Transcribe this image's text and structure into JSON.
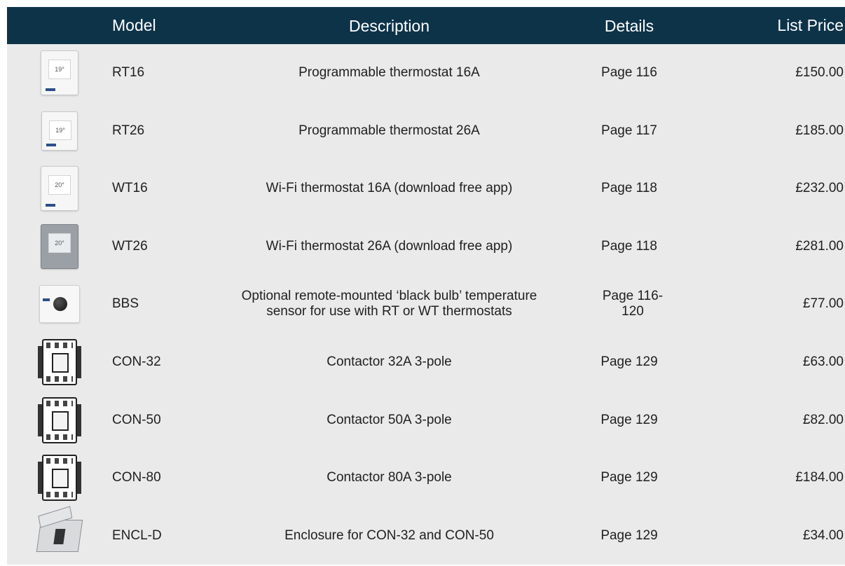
{
  "header": {
    "model": "Model",
    "description": "Description",
    "details": "Details",
    "price": "List Price"
  },
  "colors": {
    "header_bg": "#0d3349",
    "body_bg": "#eaeaea"
  },
  "rows": [
    {
      "image": "rt16-thermostat-image",
      "model": "RT16",
      "description": "Programmable thermostat 16A",
      "details": "Page 116",
      "price": "£150.00"
    },
    {
      "image": "rt26-thermostat-image",
      "model": "RT26",
      "description": "Programmable thermostat 26A",
      "details": "Page 117",
      "price": "£185.00"
    },
    {
      "image": "wt16-thermostat-image",
      "model": "WT16",
      "description": "Wi-Fi thermostat 16A (download free app)",
      "details": "Page 118",
      "price": "£232.00"
    },
    {
      "image": "wt26-thermostat-image",
      "model": "WT26",
      "description": "Wi-Fi thermostat 26A (download free app)",
      "details": "Page 118",
      "price": "£281.00"
    },
    {
      "image": "bbs-sensor-image",
      "model": "BBS",
      "description_line1": "Optional remote-mounted ‘black bulb’ temperature",
      "description_line2": "sensor for use with RT or WT thermostats",
      "details_line1": "Page 116-",
      "details_line2": "120",
      "price": "£77.00"
    },
    {
      "image": "contactor-image",
      "model": "CON-32",
      "description": "Contactor 32A 3-pole",
      "details": "Page 129",
      "price": "£63.00"
    },
    {
      "image": "contactor-image",
      "model": "CON-50",
      "description": "Contactor 50A 3-pole",
      "details": "Page 129",
      "price": "£82.00"
    },
    {
      "image": "contactor-image",
      "model": "CON-80",
      "description": "Contactor 80A 3-pole",
      "details": "Page 129",
      "price": "£184.00"
    },
    {
      "image": "enclosure-image",
      "model": "ENCL-D",
      "description": "Enclosure for CON-32 and CON-50",
      "details": "Page 129",
      "price": "£34.00"
    }
  ],
  "thumb_text": {
    "temp_a": "19°",
    "temp_b": "20°"
  }
}
